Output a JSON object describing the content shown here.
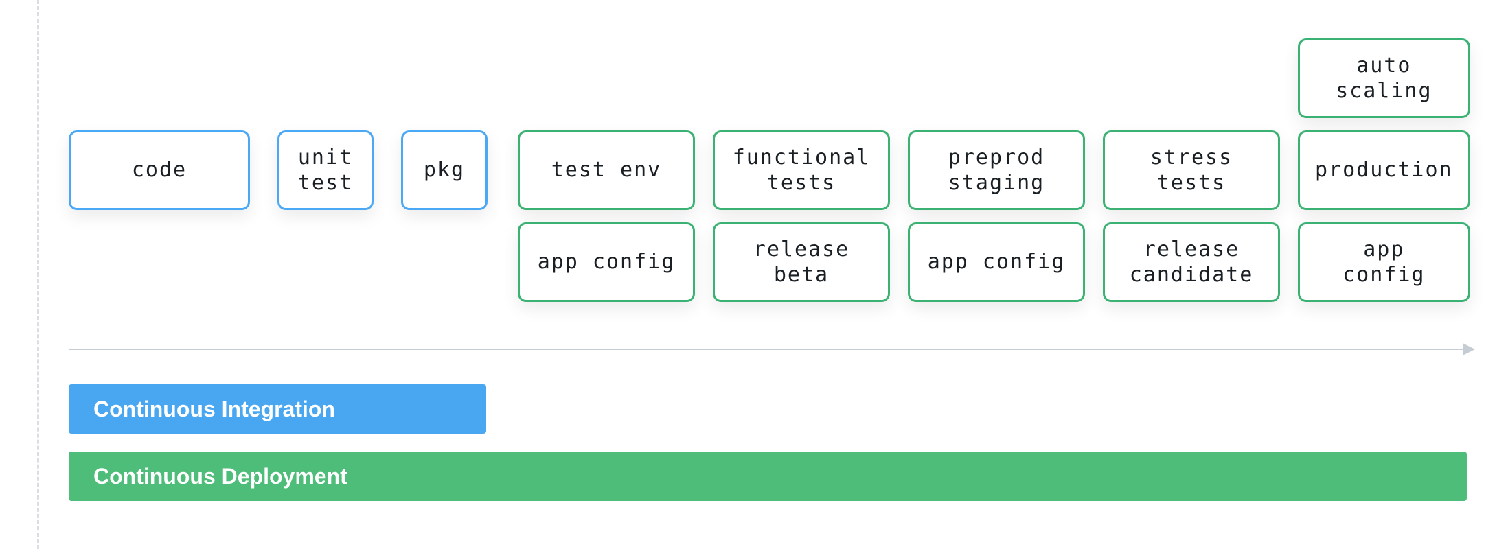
{
  "colors": {
    "blue": "#4aa8f5",
    "green": "#3bb273",
    "ci_bar": "#49a7f1",
    "cd_bar": "#4ebd7a"
  },
  "ci": {
    "code": "code",
    "unit_test": "unit\ntest",
    "pkg": "pkg"
  },
  "cd": {
    "col1": {
      "top": "test env",
      "bottom": "app config"
    },
    "col2": {
      "top": "functional\ntests",
      "bottom": "release\nbeta"
    },
    "col3": {
      "top": "preprod\nstaging",
      "bottom": "app config"
    },
    "col4": {
      "top": "stress\ntests",
      "bottom": "release\ncandidate"
    },
    "col5": {
      "above": "auto\nscaling",
      "top": "production",
      "bottom": "app\nconfig"
    }
  },
  "bars": {
    "ci_label": "Continuous Integration",
    "cd_label": "Continuous Deployment"
  }
}
